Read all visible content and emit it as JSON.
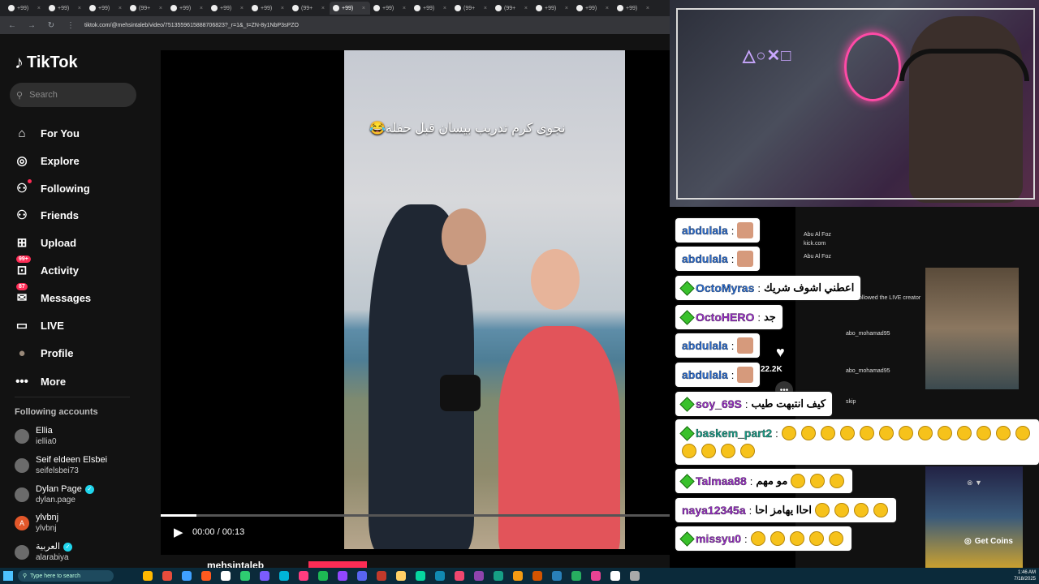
{
  "browser": {
    "tabs": [
      "+99)",
      "+99)",
      "+99)",
      "(99+",
      "+99)",
      "+99)",
      "+99)",
      "(99+",
      "+99)",
      "+99)",
      "+99)",
      "(99+",
      "(99+",
      "+99)",
      "+99)",
      "+99)"
    ],
    "url": "tiktok.com/@mehsintaleb/video/7513559615888706823?_r=1&_t=ZN-8y1NbP3sPZO"
  },
  "tiktok": {
    "logo": "TikTok",
    "search_placeholder": "Search",
    "nav": [
      {
        "label": "For You",
        "icon": "home-icon"
      },
      {
        "label": "Explore",
        "icon": "compass-icon"
      },
      {
        "label": "Following",
        "icon": "following-icon"
      },
      {
        "label": "Friends",
        "icon": "friends-icon"
      },
      {
        "label": "Upload",
        "icon": "upload-icon"
      },
      {
        "label": "Activity",
        "icon": "activity-icon",
        "badge": "99+"
      },
      {
        "label": "Messages",
        "icon": "messages-icon",
        "badge": "87"
      },
      {
        "label": "LIVE",
        "icon": "live-icon"
      },
      {
        "label": "Profile",
        "icon": "profile-avatar"
      },
      {
        "label": "More",
        "icon": "more-icon"
      }
    ],
    "following_title": "Following accounts",
    "accounts": [
      {
        "name": "Ellia",
        "username": "iellia0",
        "verified": false
      },
      {
        "name": "Seif eldeen Elsbei",
        "username": "seifelsbei73",
        "verified": false
      },
      {
        "name": "Dylan Page",
        "username": "dylan.page",
        "verified": true
      },
      {
        "name": "ylvbnj",
        "username": "ylvbnj",
        "verified": false,
        "initial": "A"
      },
      {
        "name": "العربية",
        "username": "alarabiya",
        "verified": true
      }
    ],
    "video": {
      "caption": "نجوى كرم تدريب بيسان قبل حفلة😂",
      "time": "00:00 / 00:13",
      "progress": 0.07,
      "author": "mehsintaleb",
      "likes": "22.2K"
    }
  },
  "chat": [
    {
      "user": "abdulala",
      "msg": "",
      "color": "#2b6fd6",
      "gem": false,
      "thumb": true
    },
    {
      "user": "abdulala",
      "msg": "",
      "color": "#2b6fd6",
      "gem": false,
      "thumb": true
    },
    {
      "user": "OctoMyras",
      "msg": "اعطني اشوف شريك",
      "color": "#2b6fd6",
      "gem": true,
      "thumb": false
    },
    {
      "user": "OctoHERO",
      "msg": "جد",
      "color": "#9b30c8",
      "gem": false,
      "thumb": false
    },
    {
      "user": "abdulala",
      "msg": "",
      "color": "#2b6fd6",
      "gem": false,
      "thumb": true
    },
    {
      "user": "abdulala",
      "msg": "",
      "color": "#2b6fd6",
      "gem": false,
      "thumb": true
    },
    {
      "user": "soy_69S",
      "msg": "كيف انتبهت طيب",
      "color": "#9b30c8",
      "gem": true,
      "thumb": false
    },
    {
      "user": "baskem_part2",
      "msg": "",
      "color": "#1aa08a",
      "gem": true,
      "thumb": false
    },
    {
      "user": "Talmaa88",
      "msg": "مو مهم",
      "color": "#9b30c8",
      "gem": true,
      "thumb": false
    },
    {
      "user": "naya12345a",
      "msg": "احاا يهامز احا",
      "color": "#9b30c8",
      "gem": false,
      "thumb": false
    },
    {
      "user": "missyu0",
      "msg": "",
      "color": "#9b30c8",
      "gem": false,
      "thumb": false
    }
  ],
  "mini_chat": [
    "Abu Al Foz",
    "kick.com",
    "Abu Al Foz",
    "followed the LIVE creator",
    "abo_mohamad95",
    "abo_mohamad95",
    "skip"
  ],
  "get_coins": "Get Coins",
  "taskbar": {
    "search_placeholder": "Type here to search",
    "time": "1:46 AM",
    "date": "7/18/2025"
  }
}
